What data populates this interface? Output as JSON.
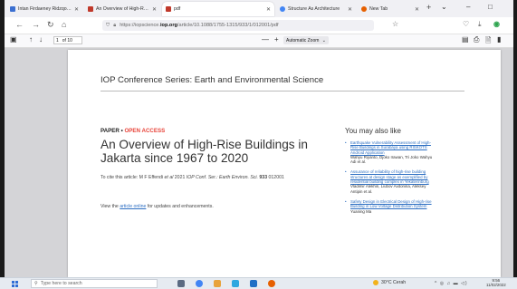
{
  "tabs": [
    {
      "label": "Intan Firdaeney Ridzqo - Go",
      "favicon": "google-scholar-icon",
      "color": "#3b6fd1"
    },
    {
      "label": "An Overview of High-Rise B",
      "favicon": "iop-icon",
      "color": "#c0392b"
    },
    {
      "label": "pdf",
      "favicon": "pdf-icon",
      "color": "#c0392b",
      "active": true
    },
    {
      "label": "Structure As Architecture",
      "favicon": "google-icon",
      "color": "#4285f4"
    },
    {
      "label": "New Tab",
      "favicon": "firefox-icon",
      "color": "#e66000"
    }
  ],
  "window_controls": {
    "minimize": "–",
    "maximize": "□"
  },
  "url": {
    "prefix": "https://iopscience.",
    "domain": "iop.org",
    "suffix": "/article/10.1088/1755-1315/933/1/012001/pdf"
  },
  "pdf_toolbar": {
    "page_current": "1",
    "page_total": "of 10",
    "zoom_minus": "—",
    "zoom_plus": "+",
    "zoom_value": "Automatic Zoom"
  },
  "page": {
    "series": "IOP Conference Series: Earth and Environmental Science",
    "kicker_paper": "PAPER",
    "kicker_sep": " • ",
    "kicker_open": "OPEN ACCESS",
    "title": "An Overview of High-Rise Buildings in Jakarta since 1967 to 2020",
    "cite_prefix": "To cite this article: M F Effendi ",
    "cite_etal": "et al",
    "cite_mid": " 2021 ",
    "cite_journal": "IOP Conf. Ser.: Earth Environ. Sci.",
    "cite_vol": " 933",
    "cite_suffix": " 012001",
    "view_prefix": "View the ",
    "view_link": "article online",
    "view_suffix": " for updates and enhancements."
  },
  "sidebar": {
    "heading": "You may also like",
    "refs": [
      {
        "title": "Earthquake Vulnerability Assessment of High-Rise Buildings in Surabaya using RISKOTS Android Application",
        "authors": "Wahyu Riyanto, Djoko Irawan, Tri Joko Wahyu Adi et al."
      },
      {
        "title": "Assurance of reliability of high-rise building structures at design stage as exemplified by residential building complex in Yekaterinburg",
        "authors": "Vladimir Alekhin, Liubov Avdonina, Aleksey Antipin et al."
      },
      {
        "title": "Safety Design in Electrical Design of High-rise Building in Low Voltage Distribution System",
        "authors": "Yuaning Ma"
      }
    ]
  },
  "taskbar": {
    "search_placeholder": "Type here to search",
    "weather": "30°C Cerah",
    "time": "9:56",
    "date": "11/02/2022"
  }
}
